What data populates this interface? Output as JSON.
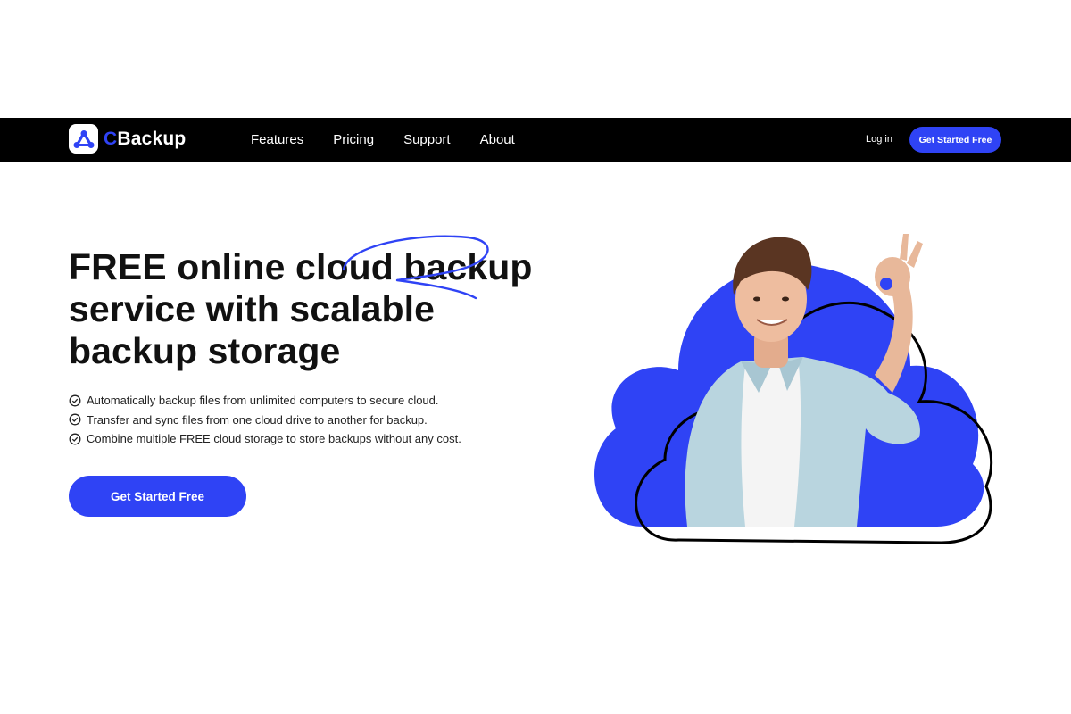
{
  "brand": {
    "logo_prefix": "C",
    "logo_name": "Backup",
    "accent_color": "#2f43f5",
    "logo_icon": "cloud-share-icon"
  },
  "nav": {
    "items": [
      {
        "label": "Features"
      },
      {
        "label": "Pricing"
      },
      {
        "label": "Support"
      },
      {
        "label": "About"
      }
    ],
    "login_label": "Log in",
    "cta_label": "Get Started Free"
  },
  "hero": {
    "title_line1": "FREE online cloud backup",
    "title_line2": "service with scalable",
    "title_line3": "backup storage",
    "features": [
      {
        "text": "Automatically backup files from unlimited computers to secure cloud.",
        "icon": "check-circle-icon"
      },
      {
        "text": "Transfer and sync files from one cloud drive to another for backup.",
        "icon": "check-circle-icon"
      },
      {
        "text": "Combine multiple FREE cloud storage to store backups without any cost.",
        "icon": "check-circle-icon"
      }
    ],
    "cta_label": "Get Started Free"
  }
}
